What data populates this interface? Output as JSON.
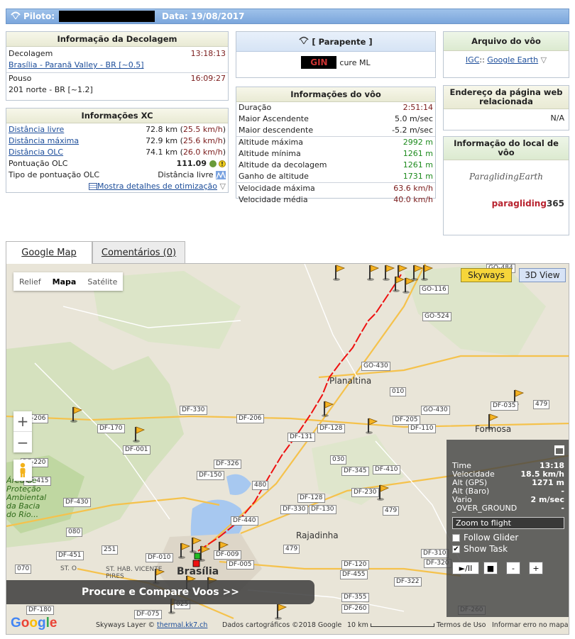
{
  "header": {
    "pilot_label": "Piloto:",
    "date_label": "Data:",
    "date": "19/08/2017"
  },
  "takeoff": {
    "title": "Informação da Decolagem",
    "takeoff_label": "Decolagem",
    "takeoff_time": "13:18:13",
    "takeoff_site": "Brasília - Paranã Valley - BR [~0.5]",
    "landing_label": "Pouso",
    "landing_time": "16:09:27",
    "landing_site": "201 norte - BR [~1.2]"
  },
  "xc": {
    "title": "Informações XC",
    "rows": [
      {
        "label": "Distância livre",
        "km": "72.8 km",
        "speed": "25.5 km/h"
      },
      {
        "label": "Distância máxima",
        "km": "72.9 km",
        "speed": "25.6 km/h"
      },
      {
        "label": "Distância OLC",
        "km": "74.1 km",
        "speed": "26.0 km/h"
      }
    ],
    "score_label": "Pontuação OLC",
    "score": "111.09",
    "type_label": "Tipo de pontuação OLC",
    "type_value": "Distância livre",
    "details_link": "Mostra detalhes de otimização"
  },
  "glider": {
    "title": "[ Parapente ]",
    "name": "cure ML",
    "brand": "GIN"
  },
  "stats": {
    "title": "Informações do vôo",
    "rows": [
      {
        "label": "Duração",
        "value": "2:51:14",
        "color": "maroon"
      },
      {
        "label": "Maior Ascendente",
        "value": "5.0 m/sec",
        "color": ""
      },
      {
        "label": "Maior descendente",
        "value": "-5.2 m/sec",
        "color": ""
      },
      {
        "label": "Altitude máxima",
        "value": "2992 m",
        "color": "green"
      },
      {
        "label": "Altitude mínima",
        "value": "1261 m",
        "color": "green"
      },
      {
        "label": "Altitude da decolagem",
        "value": "1261 m",
        "color": "green"
      },
      {
        "label": "Ganho de altitude",
        "value": "1731 m",
        "color": "green"
      },
      {
        "label": "Velocidade máxima",
        "value": "63.6 km/h",
        "color": "maroon"
      },
      {
        "label": "Velocidade média",
        "value": "40.0 km/h",
        "color": "maroon"
      }
    ]
  },
  "file": {
    "title": "Arquivo do vôo",
    "igc": "IGC",
    "google_earth": "Google Earth"
  },
  "webpage": {
    "title": "Endereço da página web relacionada",
    "value": "N/A"
  },
  "siteinfo": {
    "title": "Informação do local de vôo",
    "logo1": "ParaglidingEarth",
    "logo2_a": "paragliding",
    "logo2_b": "365"
  },
  "tabs": {
    "map": "Google Map",
    "comments": "Comentários (0)"
  },
  "map": {
    "types": [
      "Relief",
      "Mapa",
      "Satélite"
    ],
    "skyways": "Skyways",
    "view3d": "3D View",
    "compare": "Procure e Compare Voos >>",
    "towns": {
      "planaltina": "Planaltina",
      "formosa": "Formosa",
      "rajadinha": "Rajadinha",
      "brasilia": "Brasília",
      "area": "Área de Proteção Ambiental da Bacia do Rio...",
      "sthab": "ST. HAB. VICENTE PIRES",
      "sto": "ST. O"
    },
    "roads": [
      "GO-116",
      "GO-524",
      "GO-430",
      "010",
      "GO-430",
      "DF-205",
      "DF-110",
      "DF-206",
      "DF-330",
      "DF-206",
      "DF-170",
      "DF-001",
      "DF-128",
      "DF-131",
      "030",
      "DF-326",
      "DF-150",
      "DF-345",
      "DF-410",
      "DF-220",
      "DF-415",
      "DF-430",
      "DF-230",
      "DF-128",
      "DF-330",
      "DF-130",
      "479",
      "DF-440",
      "080",
      "DF-451",
      "251",
      "DF-010",
      "DF-009",
      "DF-005",
      "479",
      "DF-120",
      "DF-455",
      "DF-310",
      "DF-320",
      "DF-322",
      "DF-355",
      "DF-260",
      "DF-260",
      "070",
      "DF-180",
      "DF-075",
      "025",
      "GO-484",
      "DF-035",
      "480",
      "479"
    ],
    "footer": {
      "google": "Google",
      "skyways_layer": "Skyways Layer ©",
      "kk7": "thermal.kk7.ch",
      "data": "Dados cartográficos ©2018 Google",
      "scale": "10 km",
      "terms": "Termos de Uso",
      "report": "Informar erro no mapa"
    }
  },
  "panel": {
    "rows": [
      {
        "label": "Time",
        "value": "13:18"
      },
      {
        "label": "Velocidade",
        "value": "18.5 km/h"
      },
      {
        "label": "Alt (GPS)",
        "value": "1271 m"
      },
      {
        "label": "Alt (Baro)",
        "value": "-"
      },
      {
        "label": "Vario",
        "value": "2 m/sec"
      },
      {
        "label": "_OVER_GROUND",
        "value": "-"
      }
    ],
    "zoom_to_flight": "Zoom to flight",
    "follow": "Follow Glider",
    "show_task": "Show Task",
    "play": "►/II",
    "stop": "■",
    "minus": "-",
    "plus": "+"
  }
}
